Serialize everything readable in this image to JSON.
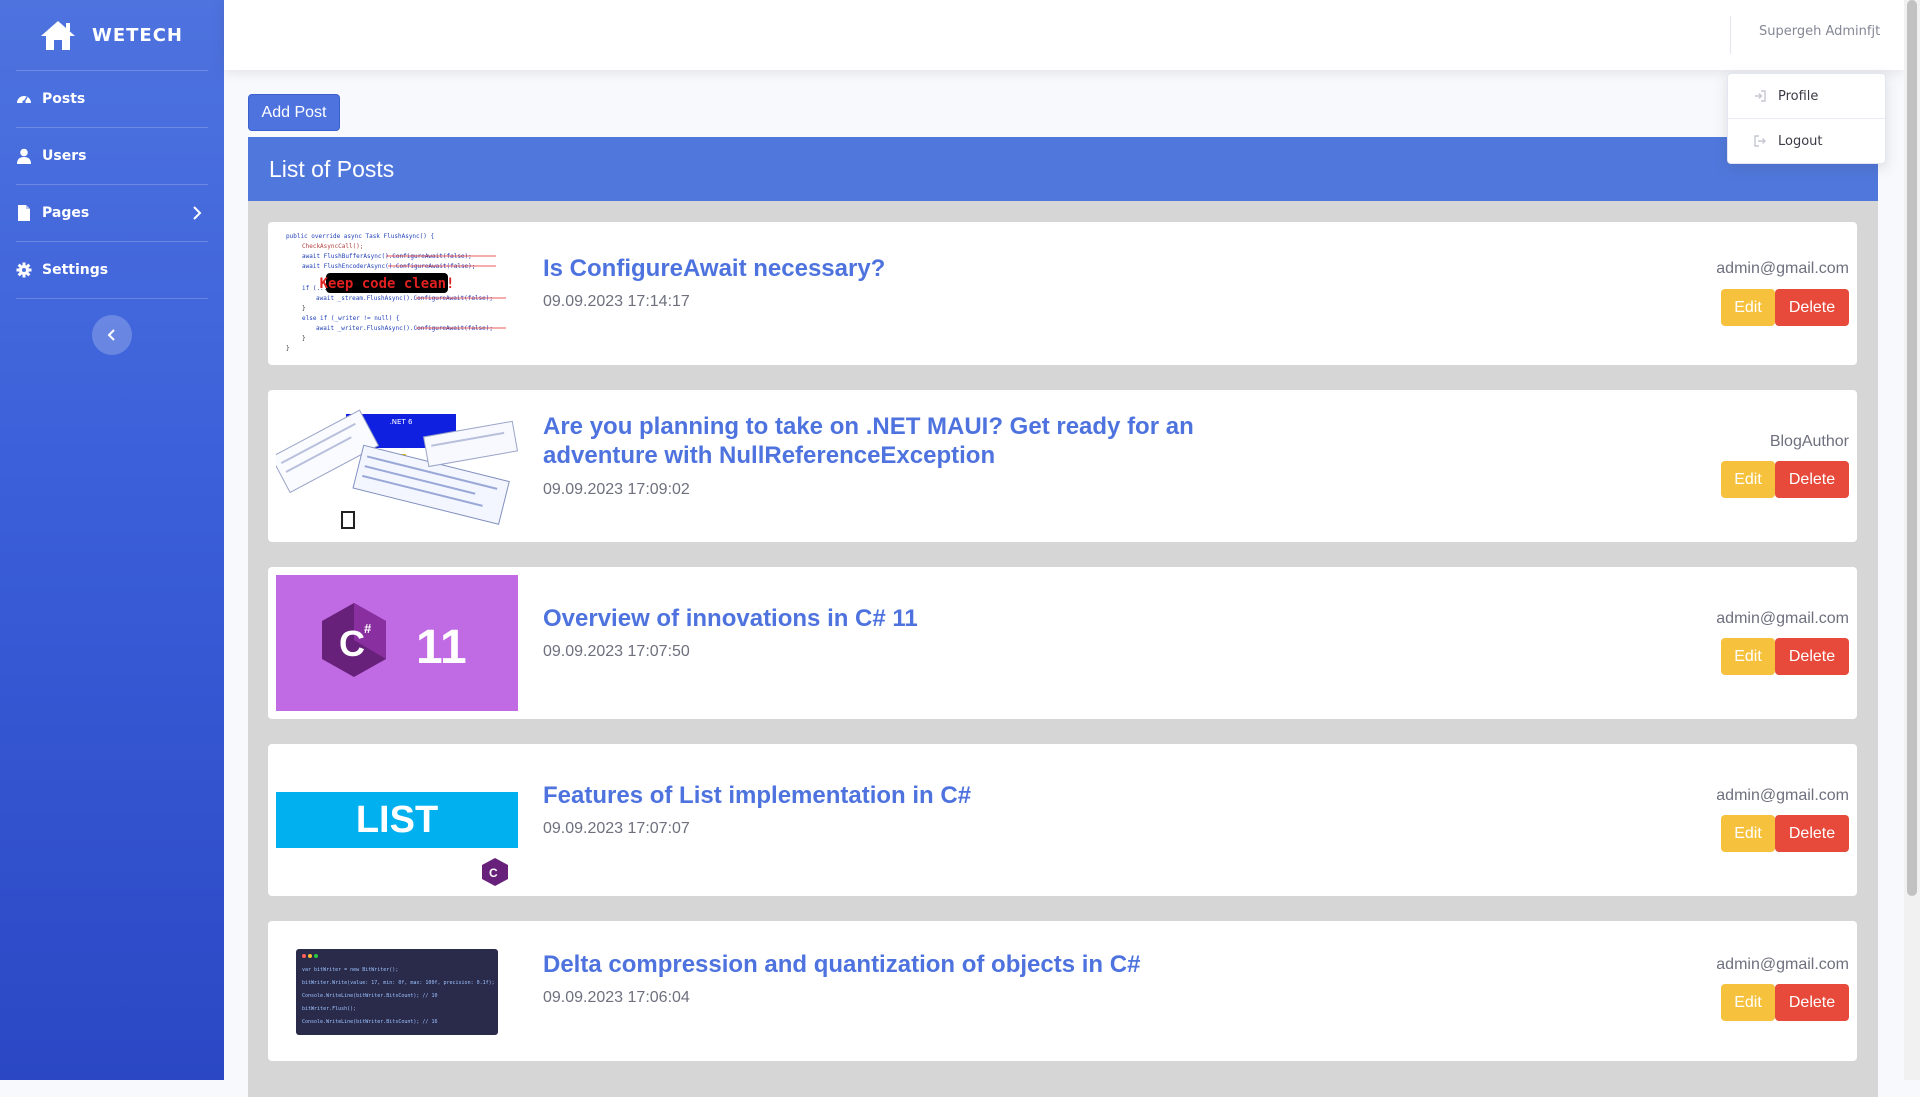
{
  "brand": {
    "name": "WETECH",
    "icon": "home-icon"
  },
  "sidebar": {
    "items": [
      {
        "label": "Posts",
        "icon": "gauge-icon"
      },
      {
        "label": "Users",
        "icon": "user-icon"
      },
      {
        "label": "Pages",
        "icon": "file-icon"
      },
      {
        "label": "Settings",
        "icon": "gear-icon"
      }
    ],
    "collapse_icon": "chevron-left-icon"
  },
  "topbar": {
    "user_name": "Supergeh Adminfjt"
  },
  "dropdown": {
    "items": [
      {
        "label": "Profile",
        "icon": "sign-in-icon"
      },
      {
        "label": "Logout",
        "icon": "sign-out-icon"
      }
    ]
  },
  "actions": {
    "add_post_label": "Add Post"
  },
  "panel": {
    "title": "List of Posts"
  },
  "posts": [
    {
      "title": "Is ConfigureAwait necessary?",
      "date": "09.09.2023 17:14:17",
      "author": "admin@gmail.com",
      "edit_label": "Edit",
      "delete_label": "Delete",
      "thumb_text": "Keep code clean!"
    },
    {
      "title": "Are you planning to take on .NET MAUI? Get ready for an adventure with NullReferenceException",
      "date": "09.09.2023 17:09:02",
      "author": "BlogAuthor",
      "edit_label": "Edit",
      "delete_label": "Delete",
      "thumb_text": ".NET 6"
    },
    {
      "title": "Overview of innovations in C# 11",
      "date": "09.09.2023 17:07:50",
      "author": "admin@gmail.com",
      "edit_label": "Edit",
      "delete_label": "Delete",
      "thumb_text": "11"
    },
    {
      "title": "Features of List implementation in C#",
      "date": "09.09.2023 17:07:07",
      "author": "admin@gmail.com",
      "edit_label": "Edit",
      "delete_label": "Delete",
      "thumb_text": "LIST"
    },
    {
      "title": "Delta compression and quantization of objects in C#",
      "date": "09.09.2023 17:06:04",
      "author": "admin@gmail.com",
      "edit_label": "Edit",
      "delete_label": "Delete",
      "thumb_text": ""
    }
  ],
  "colors": {
    "primary": "#4e73df",
    "warning": "#f6c23e",
    "danger": "#e74a3b",
    "sidebar_dark": "#2b47c4"
  }
}
